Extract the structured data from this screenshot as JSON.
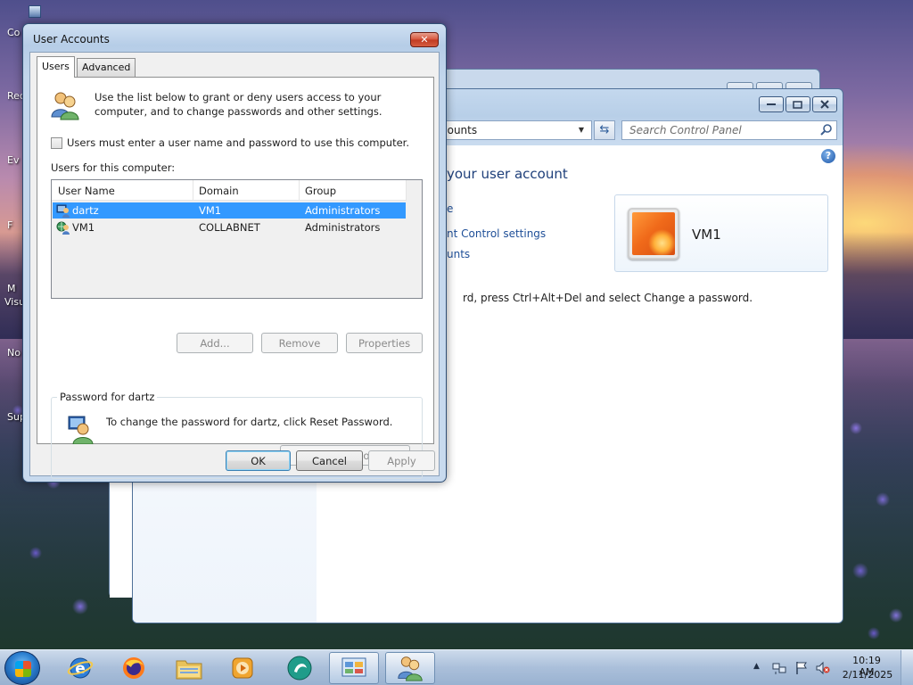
{
  "desktop": {
    "icons": [
      {
        "label": "Co"
      },
      {
        "label": "Rec"
      },
      {
        "label": "Ev"
      },
      {
        "label": "F"
      },
      {
        "label": "M"
      },
      {
        "label": "Visu"
      },
      {
        "label": "No"
      },
      {
        "label": "Sup"
      }
    ]
  },
  "control_panel": {
    "address_text": "counts",
    "search_placeholder": "Search Control Panel",
    "help_icon_text": "?",
    "heading": "your user account",
    "links": [
      "e",
      "nt Control settings",
      "unts"
    ],
    "password_text": "rd, press Ctrl+Alt+Del and select Change a password.",
    "user_card_name": "VM1"
  },
  "dialog": {
    "title": "User Accounts",
    "close_glyph": "✕",
    "tabs": [
      {
        "label": "Users",
        "active": true
      },
      {
        "label": "Advanced",
        "active": false
      }
    ],
    "intro_text": "Use the list below to grant or deny users access to your computer, and to change passwords and other settings.",
    "must_enter_label": "Users must enter a user name and password to use this computer.",
    "must_enter_checked": false,
    "users_for_label": "Users for this computer:",
    "columns": [
      "User Name",
      "Domain",
      "Group"
    ],
    "users": [
      {
        "name": "dartz",
        "domain": "VM1",
        "group": "Administrators",
        "selected": true,
        "icon": "local-user-icon"
      },
      {
        "name": "VM1",
        "domain": "COLLABNET",
        "group": "Administrators",
        "selected": false,
        "icon": "domain-user-icon"
      }
    ],
    "buttons": {
      "add": "Add...",
      "remove": "Remove",
      "properties": "Properties",
      "reset_password": "Reset Password...",
      "ok": "OK",
      "cancel": "Cancel",
      "apply": "Apply"
    },
    "password_group_title": "Password for dartz",
    "password_text": "To change the password for dartz, click Reset Password."
  },
  "taskbar": {
    "pinned": [
      {
        "name": "internet-explorer-icon"
      },
      {
        "name": "firefox-icon"
      },
      {
        "name": "file-explorer-icon"
      },
      {
        "name": "media-player-icon"
      },
      {
        "name": "bing-maps-icon"
      },
      {
        "name": "control-panel-icon",
        "active": true
      },
      {
        "name": "user-accounts-icon",
        "active": true
      }
    ],
    "tray_arrow": "▲",
    "clock_time": "10:19 AM",
    "clock_date": "2/11/2025"
  }
}
